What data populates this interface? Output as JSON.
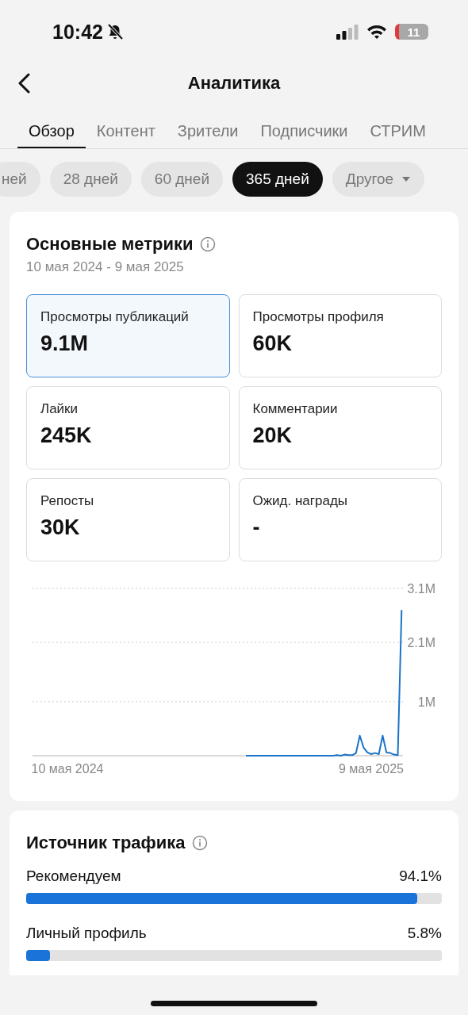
{
  "status_bar": {
    "time": "10:42",
    "battery": "11"
  },
  "header": {
    "title": "Аналитика"
  },
  "tabs": [
    {
      "label": "Обзор",
      "selected": true
    },
    {
      "label": "Контент",
      "selected": false
    },
    {
      "label": "Зрители",
      "selected": false
    },
    {
      "label": "Подписчики",
      "selected": false
    },
    {
      "label": "СТРИМ",
      "selected": false
    }
  ],
  "periods": [
    {
      "label": "ней",
      "kind": "chip",
      "selected": false
    },
    {
      "label": "28 дней",
      "kind": "chip",
      "selected": false
    },
    {
      "label": "60 дней",
      "kind": "chip",
      "selected": false
    },
    {
      "label": "365 дней",
      "kind": "chip",
      "selected": true
    },
    {
      "label": "Другое",
      "kind": "dropdown",
      "selected": false
    }
  ],
  "key_metrics": {
    "title": "Основные метрики",
    "date_range": "10 мая 2024 - 9 мая 2025",
    "metrics": [
      {
        "label": "Просмотры публикаций",
        "value": "9.1M",
        "selected": true
      },
      {
        "label": "Просмотры профиля",
        "value": "60K",
        "selected": false
      },
      {
        "label": "Лайки",
        "value": "245K",
        "selected": false
      },
      {
        "label": "Комментарии",
        "value": "20K",
        "selected": false
      },
      {
        "label": "Репосты",
        "value": "30K",
        "selected": false
      },
      {
        "label": "Ожид. награды",
        "value": "-",
        "selected": false
      }
    ],
    "chart_data": {
      "type": "line",
      "categories": [
        "10 мая 2024",
        null,
        null,
        null,
        null,
        null,
        null,
        null,
        null,
        null,
        null,
        null,
        null,
        null,
        null,
        null,
        null,
        null,
        null,
        null,
        null,
        null,
        null,
        null,
        null,
        null,
        null,
        null,
        null,
        null,
        null,
        null,
        null,
        null,
        null,
        null,
        null,
        null,
        null,
        null,
        null,
        null,
        null,
        null,
        null,
        null,
        null,
        null,
        null,
        null,
        null,
        null,
        null,
        null,
        null,
        null,
        null,
        null,
        null,
        null,
        null,
        null,
        null,
        null,
        null,
        null,
        null,
        null,
        null,
        null,
        null,
        null,
        null,
        null,
        null,
        null,
        null,
        null,
        null,
        null,
        "9 мая 2025",
        null,
        null,
        null,
        null,
        null,
        null,
        null,
        null
      ],
      "series": [
        {
          "color": "#1a73c8",
          "values": [
            null,
            null,
            null,
            null,
            null,
            null,
            null,
            null,
            null,
            null,
            null,
            null,
            null,
            null,
            null,
            null,
            null,
            null,
            null,
            null,
            null,
            null,
            null,
            null,
            null,
            null,
            null,
            null,
            null,
            null,
            null,
            null,
            null,
            null,
            null,
            null,
            null,
            null,
            null,
            null,
            null,
            null,
            null,
            null,
            null,
            null,
            null,
            0,
            0,
            0,
            0,
            0,
            0,
            0,
            0,
            0,
            0,
            0,
            0,
            0,
            0,
            0,
            0,
            0,
            0,
            0,
            0,
            0,
            0,
            0,
            0,
            0.01,
            0,
            0.02,
            0.01,
            0.01,
            0.05,
            0.37,
            0.15,
            0.06,
            0.03,
            0.05,
            0.03,
            0.37,
            0.06,
            0.05,
            0.02,
            0.01,
            2.7
          ]
        }
      ],
      "ylim": [
        0,
        3.1
      ],
      "yticks": [
        {
          "value": 1,
          "label": "1M"
        },
        {
          "value": 2.1,
          "label": "2.1M"
        },
        {
          "value": 3.1,
          "label": "3.1M"
        }
      ]
    }
  },
  "traffic_source": {
    "title": "Источник трафика",
    "items": [
      {
        "label": "Рекомендуем",
        "value": "94.1%",
        "level": 0.941
      },
      {
        "label": "Личный профиль",
        "value": "5.8%",
        "level": 0.058
      }
    ]
  }
}
